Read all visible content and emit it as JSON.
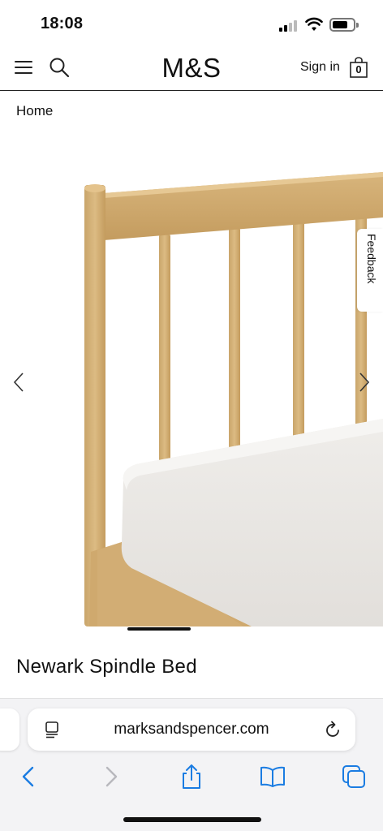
{
  "status_bar": {
    "time": "18:08",
    "icons": [
      "cellular-signal-icon",
      "wifi-icon",
      "battery-icon"
    ]
  },
  "header": {
    "logo": "M&S",
    "sign_in_label": "Sign in",
    "bag_count": "0",
    "icons": [
      "menu-icon",
      "search-icon",
      "shopping-bag-icon"
    ]
  },
  "breadcrumb": {
    "home_label": "Home"
  },
  "gallery": {
    "feedback_label": "Feedback",
    "icons": [
      "chevron-left-icon",
      "chevron-right-icon"
    ]
  },
  "product": {
    "title": "Newark Spindle Bed"
  },
  "browser": {
    "address": "marksandspencer.com",
    "icons": [
      "reader-mode-icon",
      "reload-icon",
      "back-icon",
      "forward-icon",
      "share-icon",
      "bookmarks-icon",
      "tabs-icon"
    ],
    "accent_color": "#1a7ce2",
    "disabled_color": "#b8b8bd"
  }
}
